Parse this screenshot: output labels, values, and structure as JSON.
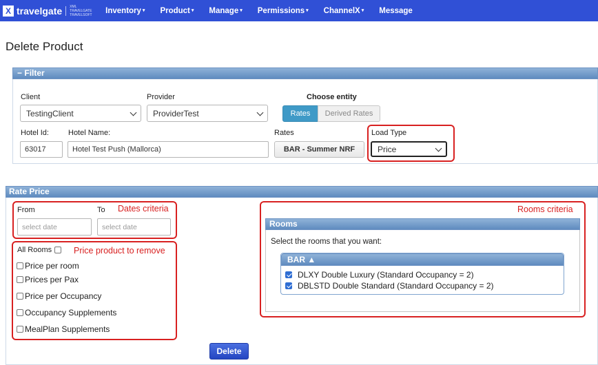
{
  "nav": {
    "logo_text": "travelgate",
    "logo_sub": "XML TRAVELGATE TRAVELSOFT",
    "items": [
      {
        "label": "Inventory",
        "caret": "▾"
      },
      {
        "label": "Product",
        "caret": "▾"
      },
      {
        "label": "Manage",
        "caret": "▾"
      },
      {
        "label": "Permissions",
        "caret": "▾"
      },
      {
        "label": "ChannelX",
        "caret": "▾"
      },
      {
        "label": "Message",
        "caret": ""
      }
    ]
  },
  "page": {
    "title": "Delete Product"
  },
  "filter": {
    "header": "Filter",
    "toggle": "−",
    "client_label": "Client",
    "client_value": "TestingClient",
    "provider_label": "Provider",
    "provider_value": "ProviderTest",
    "entity_label": "Choose entity",
    "entity_options": [
      "Rates",
      "Derived Rates"
    ],
    "entity_selected": "Rates",
    "hotel_id_label": "Hotel Id:",
    "hotel_id_value": "63017",
    "hotel_name_label": "Hotel Name:",
    "hotel_name_value": "Hotel Test Push (Mallorca)",
    "rates_label": "Rates",
    "rates_value": "BAR - Summer NRF",
    "load_type_label": "Load Type",
    "load_type_value": "Price"
  },
  "rate_price": {
    "header": "Rate Price",
    "from_label": "From",
    "to_label": "To",
    "from_placeholder": "select date",
    "to_placeholder": "select date",
    "dates_annotation": "Dates criteria",
    "price_annotation": "Price product to remove",
    "all_rooms_label": "All Rooms",
    "price_options": [
      "Price per room",
      "Prices per Pax",
      "Price per Occupancy",
      "Occupancy Supplements",
      "MealPlan Supplements"
    ],
    "rooms_annotation": "Rooms criteria",
    "rooms_header": "Rooms",
    "rooms_prompt": "Select the rooms that you want:",
    "rate_group": "BAR ▲",
    "rooms": [
      {
        "label": "DLXY Double Luxury (Standard Occupancy = 2)",
        "checked": true
      },
      {
        "label": "DBLSTD Double Standard (Standard Occupancy = 2)",
        "checked": true
      }
    ],
    "delete_button": "Delete"
  },
  "colors": {
    "navbar": "#3050d6",
    "annotation": "#d82020",
    "panel_header": "#7a9fcc",
    "primary_button": "#2f52cf"
  }
}
